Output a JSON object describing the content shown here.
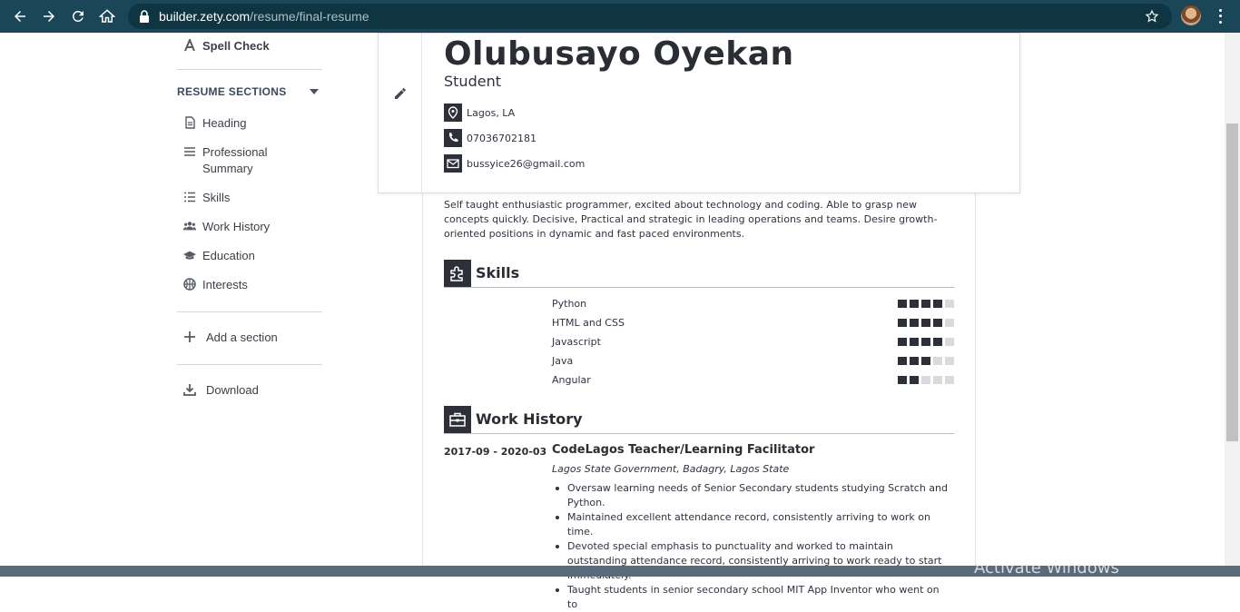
{
  "browser": {
    "url_host": "builder.zety.com",
    "url_path": "/resume/final-resume"
  },
  "sidebar": {
    "spell_check": "Spell Check",
    "sections_heading": "RESUME SECTIONS",
    "items": [
      {
        "label": "Heading",
        "icon": "document-icon"
      },
      {
        "label": "Professional Summary",
        "icon": "lines-icon"
      },
      {
        "label": "Skills",
        "icon": "list-icon"
      },
      {
        "label": "Work History",
        "icon": "users-icon"
      },
      {
        "label": "Education",
        "icon": "graduation-cap-icon"
      },
      {
        "label": "Interests",
        "icon": "basketball-icon"
      }
    ],
    "add_section": "Add a section",
    "download": "Download"
  },
  "resume": {
    "name": "Olubusayo Oyekan",
    "role": "Student",
    "location": "Lagos, LA",
    "phone": "07036702181",
    "email": "bussyice26@gmail.com",
    "summary": "Self taught enthusiastic programmer, excited about technology and coding. Able to grasp new concepts quickly. Decisive, Practical and strategic in leading operations and teams. Desire growth-oriented positions in dynamic and fast paced environments.",
    "skills_title": "Skills",
    "skills": [
      {
        "name": "Python",
        "level": 4,
        "max": 5
      },
      {
        "name": "HTML and CSS",
        "level": 4,
        "max": 5
      },
      {
        "name": "Javascript",
        "level": 4,
        "max": 5
      },
      {
        "name": "Java",
        "level": 3,
        "max": 5
      },
      {
        "name": "Angular",
        "level": 2,
        "max": 5
      }
    ],
    "work_title": "Work History",
    "job": {
      "dates": "2017-09 - 2020-03",
      "title": "CodeLagos Teacher/Learning Facilitator",
      "employer": "Lagos State Government, Badagry, Lagos State",
      "bullets": [
        "Oversaw learning needs of Senior Secondary students studying Scratch and Python.",
        "Maintained excellent attendance record, consistently arriving to work on time.",
        "Devoted special emphasis to punctuality and worked to maintain outstanding attendance record, consistently arriving to work ready to start immediately.",
        "Taught students in senior secondary school MIT App Inventor who went on to"
      ]
    }
  },
  "os": {
    "watermark": "Activate Windows"
  }
}
